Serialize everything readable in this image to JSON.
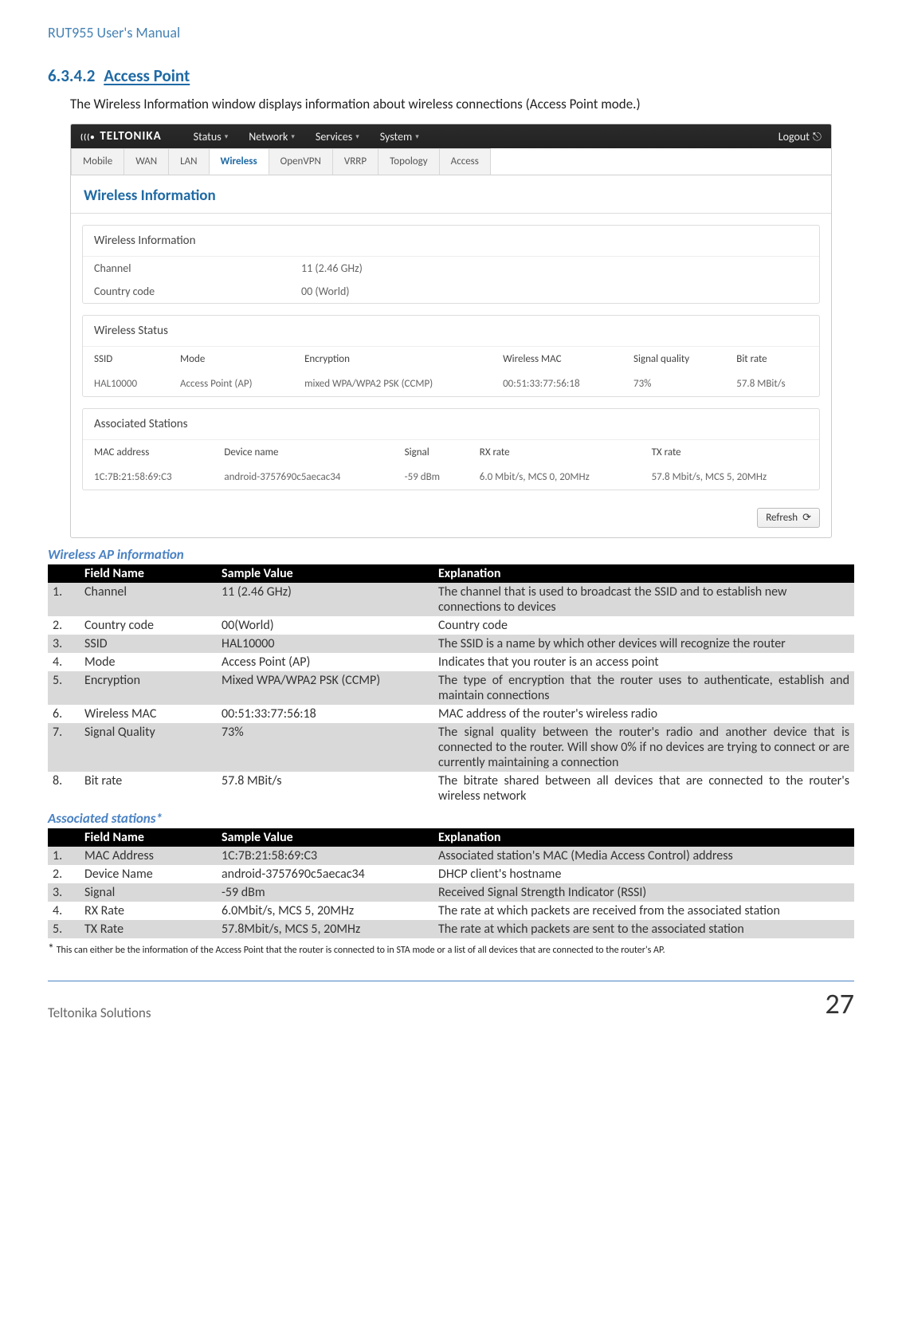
{
  "doc_header": "RUT955 User's Manual",
  "section_number": "6.3.4.2",
  "section_title": "Access Point",
  "intro": "The Wireless Information window displays information about wireless connections (Access Point mode.)",
  "shot": {
    "logo": "TELTONIKA",
    "topnav": [
      "Status",
      "Network",
      "Services",
      "System"
    ],
    "logout": "Logout",
    "tabs": [
      "Mobile",
      "WAN",
      "LAN",
      "Wireless",
      "OpenVPN",
      "VRRP",
      "Topology",
      "Access"
    ],
    "active_tab": "Wireless",
    "panel_title": "Wireless Information",
    "info_card_title": "Wireless Information",
    "info_rows": [
      {
        "k": "Channel",
        "v": "11 (2.46 GHz)"
      },
      {
        "k": "Country code",
        "v": "00 (World)"
      }
    ],
    "status_card_title": "Wireless Status",
    "status_headers": [
      "SSID",
      "Mode",
      "Encryption",
      "Wireless MAC",
      "Signal quality",
      "Bit rate"
    ],
    "status_row": [
      "HAL10000",
      "Access Point (AP)",
      "mixed WPA/WPA2 PSK (CCMP)",
      "00:51:33:77:56:18",
      "73%",
      "57.8 MBit/s"
    ],
    "assoc_card_title": "Associated Stations",
    "assoc_headers": [
      "MAC address",
      "Device name",
      "Signal",
      "RX rate",
      "TX rate"
    ],
    "assoc_row": [
      "1C:7B:21:58:69:C3",
      "android-3757690c5aecac34",
      "-59 dBm",
      "6.0 Mbit/s, MCS 0, 20MHz",
      "57.8 Mbit/s, MCS 5, 20MHz"
    ],
    "refresh": "Refresh"
  },
  "ap_heading": "Wireless AP information",
  "table_headers": {
    "field": "Field Name",
    "sample": "Sample Value",
    "explanation": "Explanation"
  },
  "ap_rows": [
    {
      "n": "1.",
      "field": "Channel",
      "sample": "11 (2.46 GHz)",
      "exp": "The channel that is used to broadcast the SSID and to establish new connections to devices"
    },
    {
      "n": "2.",
      "field": "Country code",
      "sample": "00(World)",
      "exp": "Country code"
    },
    {
      "n": "3.",
      "field": "SSID",
      "sample": "HAL10000",
      "exp": "The SSID is a name by which other devices will recognize the router"
    },
    {
      "n": "4.",
      "field": "Mode",
      "sample": "Access Point (AP)",
      "exp": "Indicates that you router is an access point"
    },
    {
      "n": "5.",
      "field": "Encryption",
      "sample": "Mixed WPA/WPA2 PSK (CCMP)",
      "exp": "The type of encryption that the router uses to authenticate, establish and maintain connections"
    },
    {
      "n": "6.",
      "field": "Wireless MAC",
      "sample": "00:51:33:77:56:18",
      "exp": "MAC address of the router's wireless radio"
    },
    {
      "n": "7.",
      "field": "Signal Quality",
      "sample": "73%",
      "exp": "The signal quality between the router's radio and another device that is connected to the router. Will show 0% if no devices are trying to connect or are currently maintaining a connection"
    },
    {
      "n": "8.",
      "field": "Bit rate",
      "sample": "57.8 MBit/s",
      "exp": "The bitrate shared between all devices that are connected to the router's wireless network"
    }
  ],
  "as_heading": "Associated stations*",
  "as_rows": [
    {
      "n": "1.",
      "field": "MAC Address",
      "sample": "1C:7B:21:58:69:C3",
      "exp": "Associated station's MAC (Media Access Control) address"
    },
    {
      "n": "2.",
      "field": "Device Name",
      "sample": "android-3757690c5aecac34",
      "exp": "DHCP client's hostname"
    },
    {
      "n": "3.",
      "field": "Signal",
      "sample": "-59 dBm",
      "exp": "Received Signal Strength Indicator (RSSI)"
    },
    {
      "n": "4.",
      "field": "RX Rate",
      "sample": "6.0Mbit/s, MCS 5, 20MHz",
      "exp": "The rate at which packets are received from the associated station"
    },
    {
      "n": "5.",
      "field": "TX Rate",
      "sample": "57.8Mbit/s, MCS 5, 20MHz",
      "exp": "The rate at which packets are sent to the associated station"
    }
  ],
  "footnote": "This can either be the information of the Access Point that the router is connected to in STA mode or a list of all devices that are connected to the router's AP.",
  "footer": "Teltonika Solutions",
  "page": "27"
}
